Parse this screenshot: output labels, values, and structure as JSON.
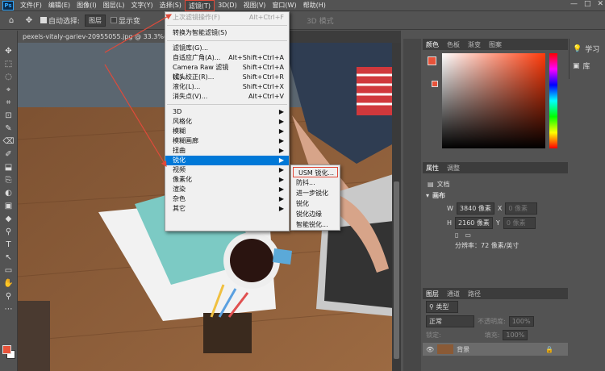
{
  "menubar": {
    "logo": "Ps",
    "items": [
      "文件(F)",
      "编辑(E)",
      "图像(I)",
      "图层(L)",
      "文字(Y)",
      "选择(S)",
      "滤镜(T)",
      "3D(D)",
      "视图(V)",
      "窗口(W)",
      "帮助(H)"
    ]
  },
  "window_controls": [
    "—",
    "□",
    "✕"
  ],
  "options": {
    "auto_select_label": "自动选择:",
    "layer_value": "图层",
    "show_transform": "显示变",
    "mode_3d": "3D 模式"
  },
  "document_tab": "pexels-vitaly-gariev-20955055.jpg @ 33.3%(RGB/8)",
  "filter_menu": {
    "top": [
      {
        "label": "上次滤镜操作(F)",
        "shortcut": "Alt+Ctrl+F",
        "disabled": true
      },
      {
        "label": "转换为智能滤镜(S)",
        "shortcut": ""
      }
    ],
    "middle": [
      {
        "label": "滤镜库(G)...",
        "shortcut": ""
      },
      {
        "label": "自适应广角(A)...",
        "shortcut": "Alt+Shift+Ctrl+A"
      },
      {
        "label": "Camera Raw 滤镜(C)...",
        "shortcut": "Shift+Ctrl+A"
      },
      {
        "label": "镜头校正(R)...",
        "shortcut": "Shift+Ctrl+R"
      },
      {
        "label": "液化(L)...",
        "shortcut": "Shift+Ctrl+X"
      },
      {
        "label": "消失点(V)...",
        "shortcut": "Alt+Ctrl+V"
      }
    ],
    "groups": [
      "3D",
      "风格化",
      "模糊",
      "模糊画廊",
      "扭曲",
      "锐化",
      "视频",
      "像素化",
      "渲染",
      "杂色",
      "其它"
    ],
    "highlighted": "锐化",
    "submenu_arrow": "▶"
  },
  "sharpen_submenu": [
    "USM 锐化...",
    "防抖...",
    "进一步锐化",
    "锐化",
    "锐化边缘",
    "智能锐化..."
  ],
  "panels": {
    "color_tabs": [
      "颜色",
      "色板",
      "渐变",
      "图案"
    ],
    "learn": [
      "学习",
      "库"
    ],
    "props_tabs": [
      "属性",
      "调整"
    ],
    "doc_label": "文档",
    "canvas_label": "画布",
    "w_label": "W",
    "w_value": "3840 像素",
    "x_label": "X",
    "x_placeholder": "0 像素",
    "h_label": "H",
    "h_value": "2160 像素",
    "y_label": "Y",
    "y_placeholder": "0 像素",
    "resolution": "分辨率：72 像素/英寸",
    "layers_tabs": [
      "图层",
      "通道",
      "路径"
    ],
    "kind_label": "类型",
    "blend_mode": "正常",
    "opacity_label": "不透明度:",
    "opacity_value": "100%",
    "lock_label": "锁定:",
    "fill_label": "填充:",
    "fill_value": "100%",
    "layer_name": "背景"
  },
  "tools": [
    "✥",
    "⬚",
    "◌",
    "⌖",
    "⌗",
    "⊡",
    "✎",
    "⌫",
    "✐",
    "⬓",
    "⎘",
    "◐",
    "▣",
    "◆",
    "⚲",
    "T",
    "↖",
    "▭",
    "✋",
    "⚲",
    "⋯"
  ]
}
